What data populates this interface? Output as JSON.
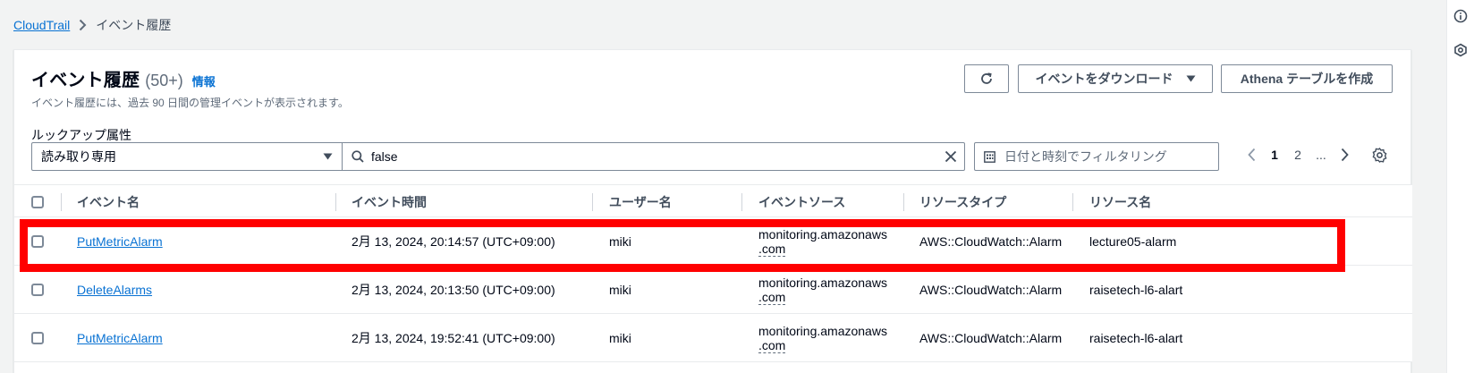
{
  "breadcrumb": {
    "root": "CloudTrail",
    "current": "イベント履歴"
  },
  "header": {
    "title": "イベント履歴",
    "count": "(50+)",
    "info": "情報",
    "description": "イベント履歴には、過去 90 日間の管理イベントが表示されます。",
    "download_label": "イベントをダウンロード",
    "athena_label": "Athena テーブルを作成"
  },
  "filters": {
    "lookup_label": "ルックアップ属性",
    "lookup_value": "読み取り専用",
    "search_value": "false",
    "date_placeholder": "日付と時刻でフィルタリング"
  },
  "pagination": {
    "pages": [
      "1",
      "2",
      "..."
    ],
    "current": "1"
  },
  "table": {
    "columns": [
      "イベント名",
      "イベント時間",
      "ユーザー名",
      "イベントソース",
      "リソースタイプ",
      "リソース名"
    ],
    "rows": [
      {
        "event": "PutMetricAlarm",
        "time": "2月 13, 2024, 20:14:57 (UTC+09:00)",
        "user": "miki",
        "source_1": "monitoring.amazonaws",
        "source_2": ".com",
        "type": "AWS::CloudWatch::Alarm",
        "resource": "lecture05-alarm"
      },
      {
        "event": "DeleteAlarms",
        "time": "2月 13, 2024, 20:13:50 (UTC+09:00)",
        "user": "miki",
        "source_1": "monitoring.amazonaws",
        "source_2": ".com",
        "type": "AWS::CloudWatch::Alarm",
        "resource": "raisetech-l6-alart"
      },
      {
        "event": "PutMetricAlarm",
        "time": "2月 13, 2024, 19:52:41 (UTC+09:00)",
        "user": "miki",
        "source_1": "monitoring.amazonaws",
        "source_2": ".com",
        "type": "AWS::CloudWatch::Alarm",
        "resource": "raisetech-l6-alart"
      }
    ]
  },
  "colors": {
    "link": "#0972d3",
    "highlight": "#ff0000",
    "border": "#7d8998"
  },
  "icons": [
    "info-icon",
    "security-icon",
    "refresh-icon",
    "caret-down-icon",
    "search-icon",
    "clear-icon",
    "calendar-icon",
    "chevron-left-icon",
    "chevron-right-icon",
    "settings-icon"
  ]
}
